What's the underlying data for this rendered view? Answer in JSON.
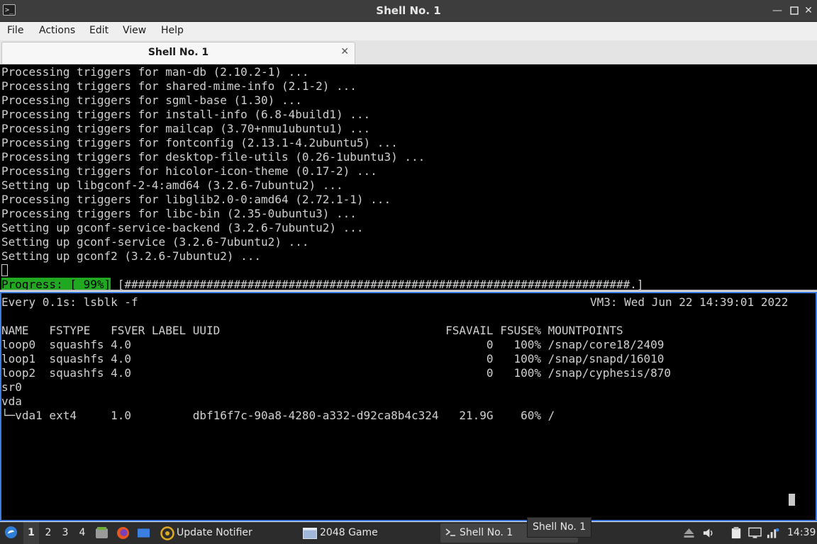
{
  "window": {
    "title": "Shell No. 1",
    "controls": [
      "minimize-icon",
      "maximize-icon",
      "close-icon"
    ]
  },
  "menu": [
    "File",
    "Actions",
    "Edit",
    "View",
    "Help"
  ],
  "tabs": [
    {
      "label": "Shell No. 1",
      "close_icon": "close-icon"
    }
  ],
  "terminal_top": {
    "lines": [
      "Processing triggers for man-db (2.10.2-1) ...",
      "Processing triggers for shared-mime-info (2.1-2) ...",
      "Processing triggers for sgml-base (1.30) ...",
      "Processing triggers for install-info (6.8-4build1) ...",
      "Processing triggers for mailcap (3.70+nmu1ubuntu1) ...",
      "Processing triggers for fontconfig (2.13.1-4.2ubuntu5) ...",
      "Processing triggers for desktop-file-utils (0.26-1ubuntu3) ...",
      "Processing triggers for hicolor-icon-theme (0.17-2) ...",
      "Setting up libgconf-2-4:amd64 (3.2.6-7ubuntu2) ...",
      "Processing triggers for libglib2.0-0:amd64 (2.72.1-1) ...",
      "Processing triggers for libc-bin (2.35-0ubuntu3) ...",
      "Setting up gconf-service-backend (3.2.6-7ubuntu2) ...",
      "Setting up gconf-service (3.2.6-7ubuntu2) ...",
      "Setting up gconf2 (3.2.6-7ubuntu2) ..."
    ],
    "progress": {
      "label": "Progress: [ 99%]",
      "bar": " [##########################################################################.]",
      "percent": 99
    }
  },
  "terminal_bottom": {
    "header_left": "Every 0.1s: lsblk -f",
    "header_right": "VM3: Wed Jun 22 14:39:01 2022",
    "columns_line": "NAME   FSTYPE   FSVER LABEL UUID                                 FSAVAIL FSUSE% MOUNTPOINTS",
    "rows": [
      "loop0  squashfs 4.0                                                    0   100% /snap/core18/2409",
      "loop1  squashfs 4.0                                                    0   100% /snap/snapd/16010",
      "loop2  squashfs 4.0                                                    0   100% /snap/cyphesis/870",
      "sr0",
      "vda",
      "└─vda1 ext4     1.0         dbf16f7c-90a8-4280-a332-d92ca8b4c324   21.9G    60% /"
    ]
  },
  "taskbar": {
    "workspaces": [
      "1",
      "2",
      "3",
      "4"
    ],
    "tasks": [
      {
        "label": "Update Notifier",
        "icon": "update-notifier-icon"
      },
      {
        "label": "2048 Game",
        "icon": "game-window-icon"
      },
      {
        "label": "Shell No. 1",
        "icon": "terminal-icon"
      }
    ],
    "tooltip": "Shell No. 1",
    "clock": "14:39",
    "tray_icons": [
      "eject-icon",
      "volume-icon",
      "clipboard-icon",
      "display-icon",
      "network-icon"
    ]
  }
}
